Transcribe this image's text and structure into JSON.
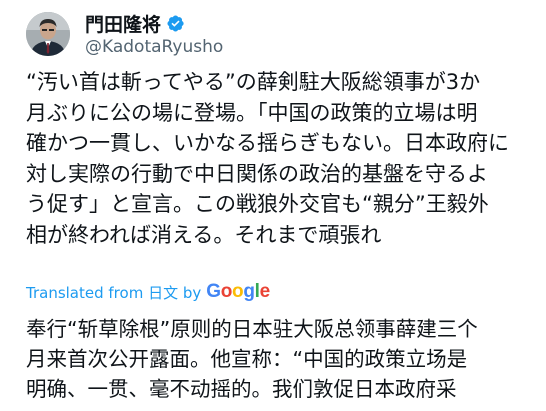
{
  "author": {
    "display_name": "門田隆将",
    "handle": "@KadotaRyusho",
    "avatar_icon": "person-avatar",
    "verified_icon": "verified-badge-icon",
    "verified_color": "#1d9bf0"
  },
  "tweet": {
    "lines": [
      "“汚い首は斬ってやる”の薛剣駐大阪総領事が3か",
      "月ぶりに公の場に登場。「中国の政策的立場は明",
      "確かつ一貫し、いかなる揺らぎもない。日本政府に",
      "対し実際の行動で中日関係の政治的基盤を守るよ",
      "う促す」と宣言。この戦狼外交官も“親分”王毅外",
      "相が終われば消える。それまで頑張れ"
    ]
  },
  "translation_bar": {
    "prefix": "Translated from 日文 by",
    "google_letters": [
      "G",
      "o",
      "o",
      "g",
      "l",
      "e"
    ],
    "accent_color": "#1d9bf0"
  },
  "translation": {
    "lines": [
      "奉行“斩草除根”原则的日本驻大阪总领事薛建三个",
      "月来首次公开露面。他宣称：“中国的政策立场是",
      "明确、一贯、毫不动摇的。我们敦促日本政府采"
    ]
  }
}
